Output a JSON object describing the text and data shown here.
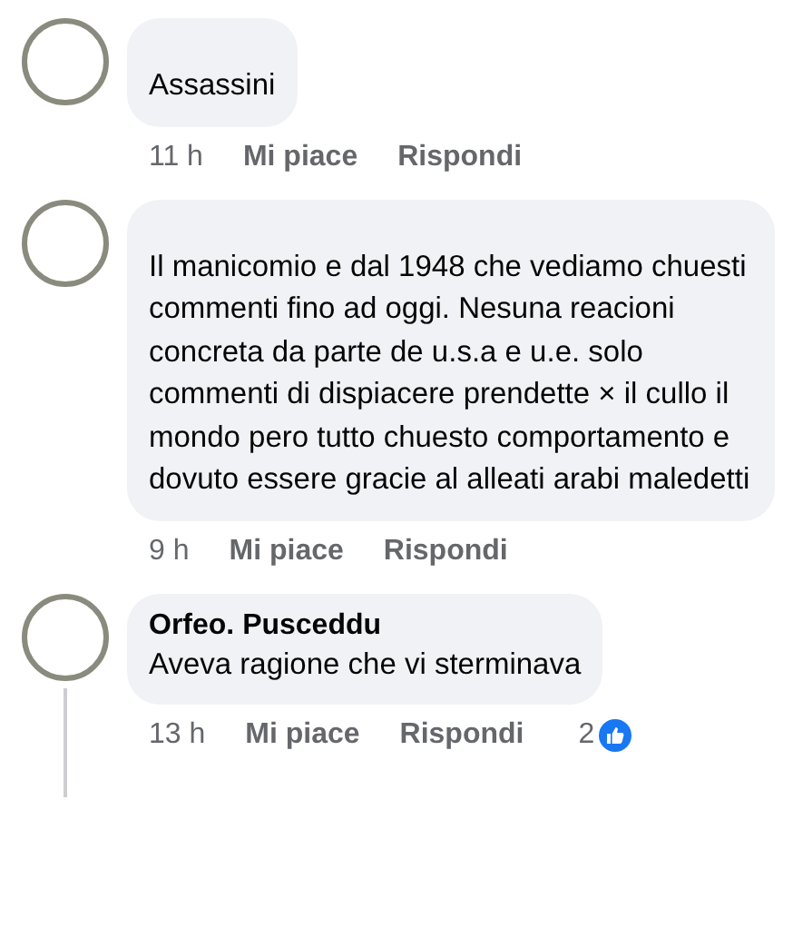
{
  "comments": [
    {
      "text": "Assassini",
      "time": "11 h",
      "like": "Mi piace",
      "reply": "Rispondi",
      "has_replies": false
    },
    {
      "text": "Il manicomio e dal 1948 che vediamo chuesti commenti fino ad oggi. Nesuna reacioni concreta da parte de u.s.a e u.e. solo commenti di dispiacere prendette × il cullo il mondo pero tutto chuesto comportamento e dovuto essere gracie al alleati arabi maledetti",
      "time": "9 h",
      "like": "Mi piace",
      "reply": "Rispondi",
      "has_replies": false
    },
    {
      "name": "Orfeo. Pusceddu",
      "text": "Aveva ragione che vi sterminava",
      "time": "13 h",
      "like": "Mi piace",
      "reply": "Rispondi",
      "reactions": "2",
      "has_replies": true
    }
  ]
}
